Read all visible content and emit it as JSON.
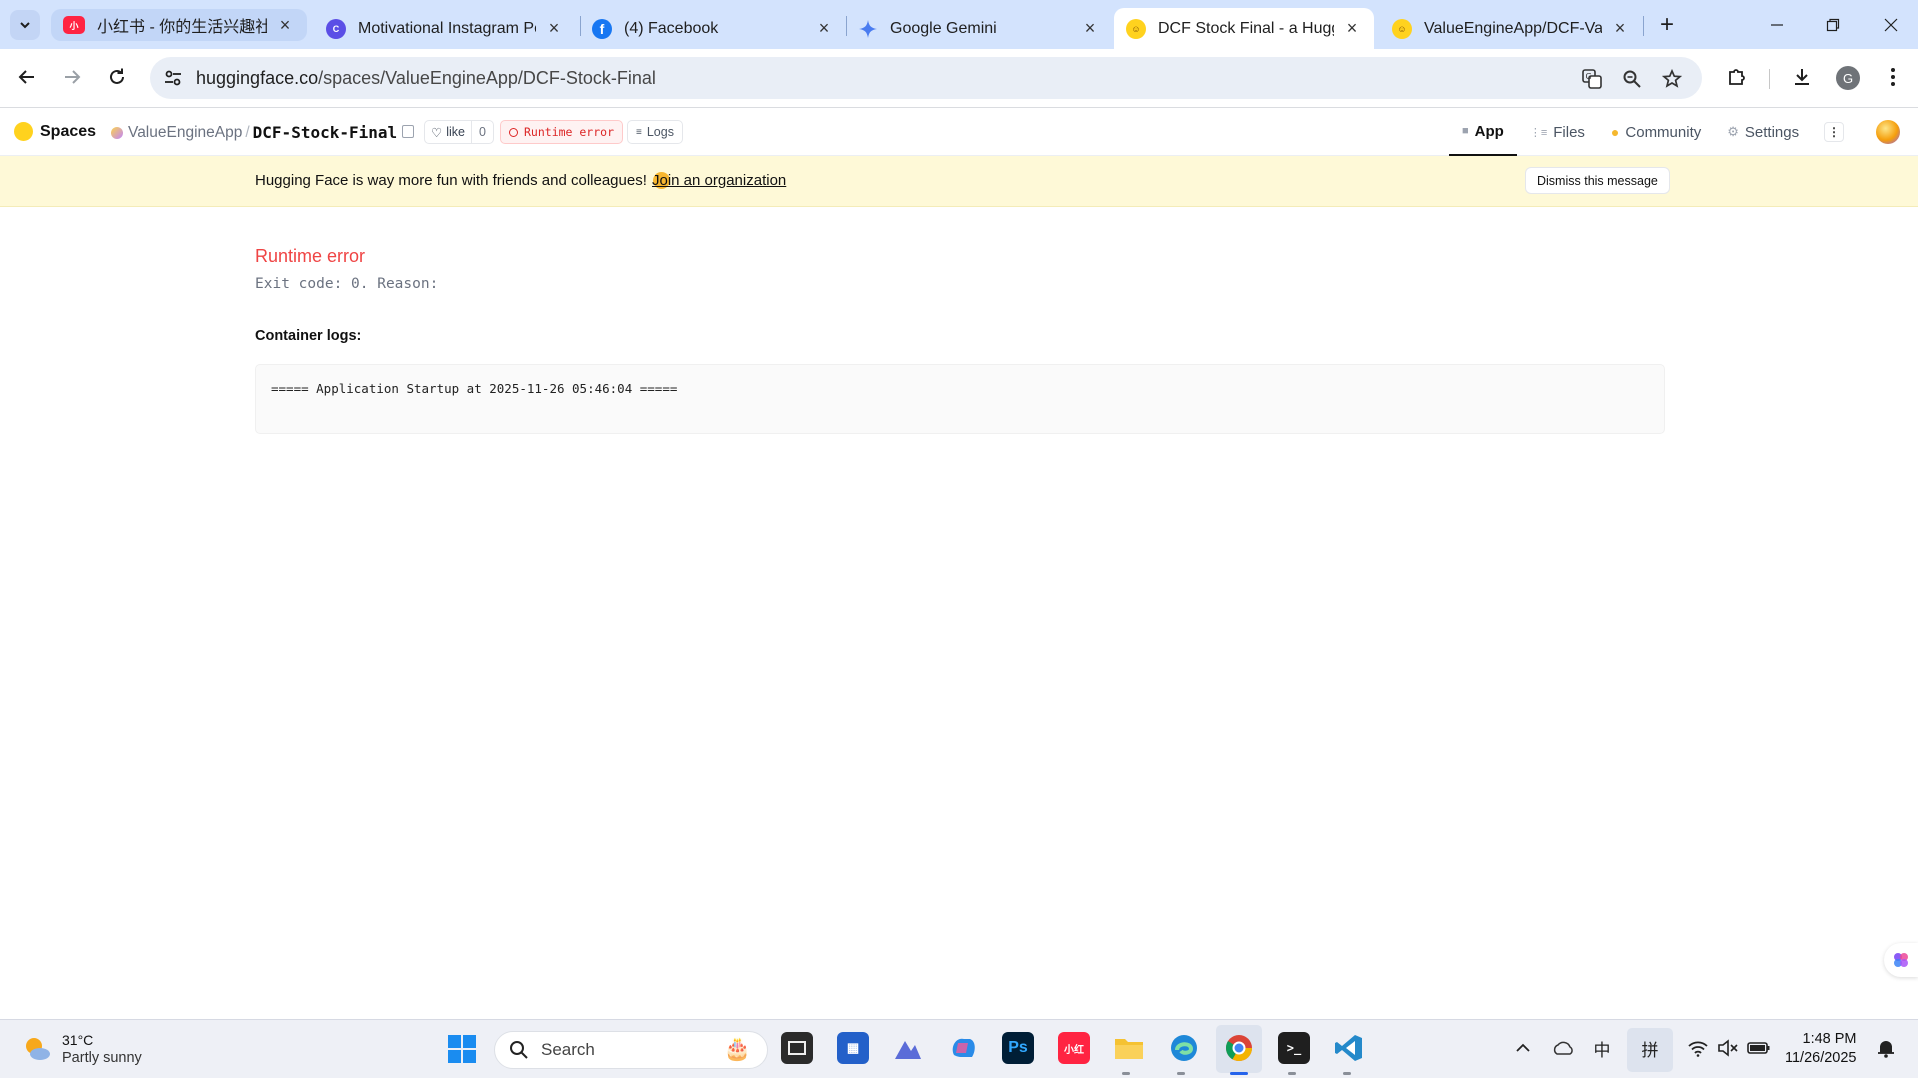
{
  "browser": {
    "tabs": [
      {
        "title": "小红书 - 你的生活兴趣社区",
        "favicon": "xiaohongshu-icon",
        "state": "hover"
      },
      {
        "title": "Motivational Instagram Po",
        "favicon": "canva-icon",
        "state": "normal"
      },
      {
        "title": "(4) Facebook",
        "favicon": "facebook-icon",
        "state": "normal"
      },
      {
        "title": "Google Gemini",
        "favicon": "gemini-icon",
        "state": "normal"
      },
      {
        "title": "DCF Stock Final - a Huggin",
        "favicon": "huggingface-icon",
        "state": "active"
      },
      {
        "title": "ValueEngineApp/DCF-Valu",
        "favicon": "huggingface-icon",
        "state": "normal"
      }
    ],
    "address": {
      "host": "huggingface.co",
      "path": "/spaces/ValueEngineApp/DCF-Stock-Final"
    },
    "profile_initial": "G"
  },
  "hf": {
    "logo_label": "Spaces",
    "owner": "ValueEngineApp",
    "separator": "/",
    "repo": "DCF-Stock-Final",
    "like_label": "like",
    "like_count": "0",
    "status_label": "Runtime error",
    "logs_label": "Logs",
    "nav": [
      {
        "label": "App",
        "icon": "app-icon",
        "active": true
      },
      {
        "label": "Files",
        "icon": "files-icon",
        "active": false
      },
      {
        "label": "Community",
        "icon": "community-icon",
        "active": false
      },
      {
        "label": "Settings",
        "icon": "gear-icon",
        "active": false
      }
    ]
  },
  "banner": {
    "message": "Hugging Face is way more fun with friends and colleagues!",
    "join_label": "Join an organization",
    "dismiss_label": "Dismiss this message"
  },
  "main": {
    "error_title": "Runtime error",
    "error_reason": "Exit code: 0. Reason:",
    "logs_title": "Container logs:",
    "log_line": "===== Application Startup at 2025-11-26 05:46:04 ====="
  },
  "taskbar": {
    "weather_temp": "31°C",
    "weather_desc": "Partly sunny",
    "search_label": "Search",
    "ime_lang": "中",
    "ime_mode": "拼",
    "time": "1:48 PM",
    "date": "11/26/2025"
  },
  "colors": {
    "chrome_frame": "#d3e3fd",
    "error_red": "#ef4444",
    "banner_bg": "#fef9d7"
  }
}
